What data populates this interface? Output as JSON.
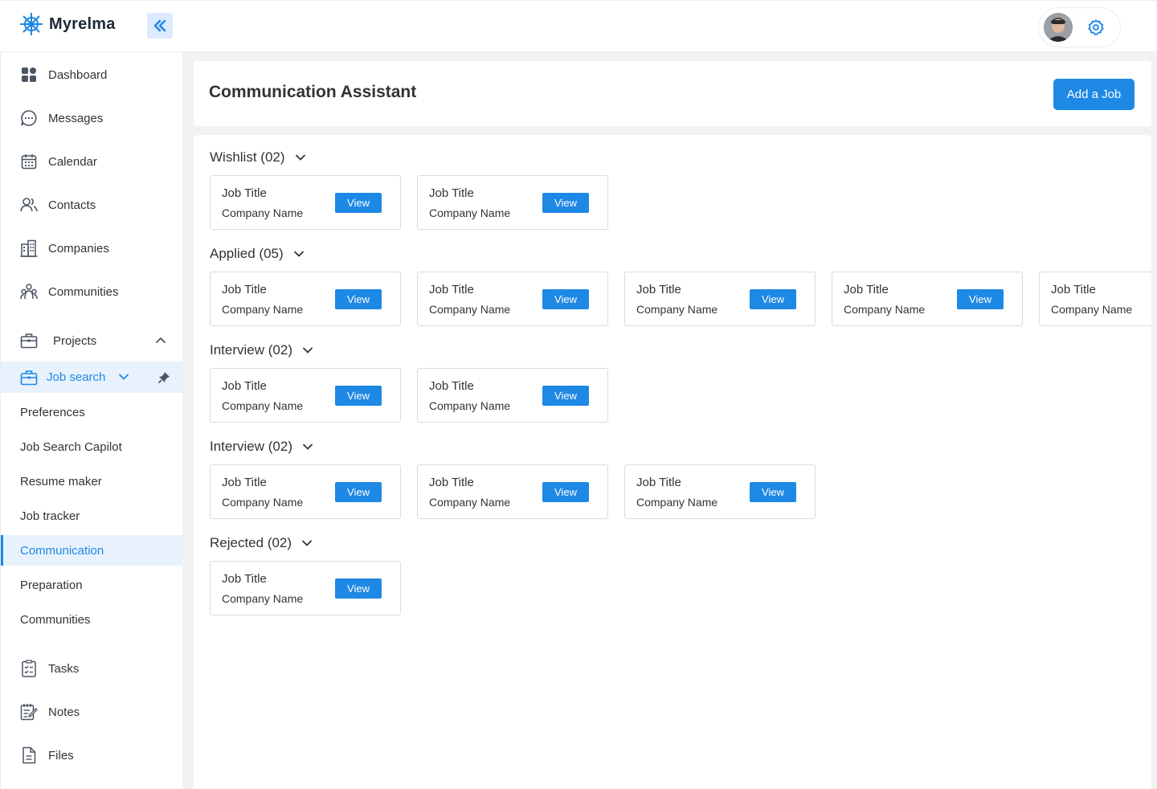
{
  "app": {
    "name": "Myrelma"
  },
  "sidebar": {
    "items": [
      {
        "label": "Dashboard",
        "icon": "dashboard-icon"
      },
      {
        "label": "Messages",
        "icon": "message-icon"
      },
      {
        "label": "Calendar",
        "icon": "calendar-icon"
      },
      {
        "label": "Contacts",
        "icon": "contacts-icon"
      },
      {
        "label": "Companies",
        "icon": "building-icon"
      },
      {
        "label": "Communities",
        "icon": "community-icon"
      },
      {
        "label": "Projects",
        "icon": "briefcase-icon"
      },
      {
        "label": "Job search",
        "icon": "briefcase-icon"
      }
    ],
    "sub_items": [
      "Preferences",
      "Job Search Capilot",
      "Resume maker",
      "Job tracker",
      "Communication",
      "Preparation",
      "Communities"
    ],
    "bottom_items": [
      {
        "label": "Tasks",
        "icon": "tasks-icon"
      },
      {
        "label": "Notes",
        "icon": "notes-icon"
      },
      {
        "label": "Files",
        "icon": "file-icon"
      }
    ]
  },
  "header": {
    "title": "Communication Assistant",
    "add_button": "Add a Job"
  },
  "sections": [
    {
      "label": "Wishlist (02)"
    },
    {
      "label": "Applied (05)"
    },
    {
      "label": "Interview (02)"
    },
    {
      "label": "Interview (02)"
    },
    {
      "label": "Rejected (02)"
    }
  ],
  "card": {
    "job_title": "Job Title",
    "company_name": "Company Name",
    "view_label": "View"
  },
  "colors": {
    "accent": "#1e88e5",
    "accent_light": "#e8f2fc"
  }
}
